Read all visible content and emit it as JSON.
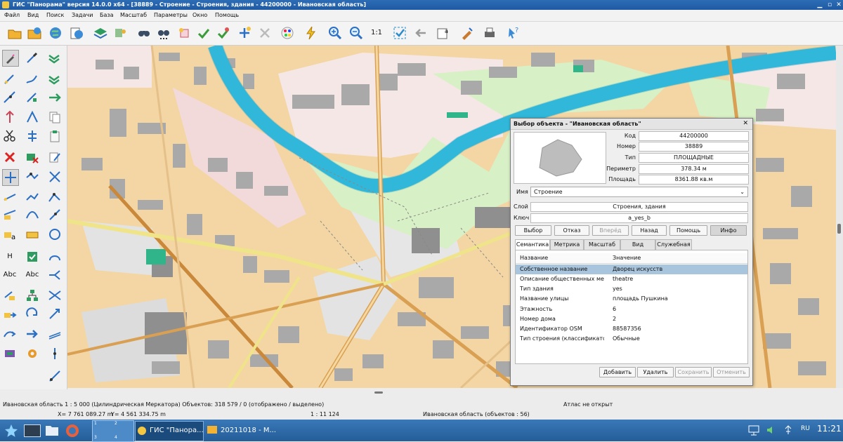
{
  "window": {
    "title": "ГИС \"Панорама\" версия 14.0.0 x64 - [38889 - Строение - Строения, здания - 44200000 - Ивановская область]"
  },
  "menu": [
    "Файл",
    "Вид",
    "Поиск",
    "Задачи",
    "База",
    "Масштаб",
    "Параметры",
    "Окно",
    "Помощь"
  ],
  "toolbar": {
    "zoom_reset_label": "1:1"
  },
  "left_tools": {
    "text_tool_1": "Abc",
    "text_tool_2": "Abc",
    "height_tool": "H"
  },
  "dialog": {
    "title": "Выбор объекта - \"Ивановская область\"",
    "props": [
      {
        "label": "Код",
        "value": "44200000"
      },
      {
        "label": "Номер",
        "value": "38889"
      },
      {
        "label": "Тип",
        "value": "ПЛОЩАДНЫЕ"
      },
      {
        "label": "Периметр",
        "value": "378.34  м"
      },
      {
        "label": "Площадь",
        "value": "8361.88  кв.м"
      }
    ],
    "name_label": "Имя",
    "name_value": "Строение",
    "layer_label": "Слой",
    "layer_value": "Строения, здания",
    "key_label": "Ключ",
    "key_value": "a_yes_b",
    "buttons": [
      "Выбор",
      "Отказ",
      "Вперёд",
      "Назад",
      "Помощь",
      "Инфо"
    ],
    "tabs": [
      "Семантика",
      "Метрика",
      "Масштаб",
      "Вид",
      "Служебная"
    ],
    "table": {
      "col_name": "Название",
      "col_value": "Значение",
      "rows": [
        {
          "name": "Собственное название",
          "value": "Дворец искусств"
        },
        {
          "name": "Описание общественных мест",
          "value": "theatre"
        },
        {
          "name": "Тип здания",
          "value": "yes"
        },
        {
          "name": "Название улицы",
          "value": "площадь Пушкина"
        },
        {
          "name": "Этажность",
          "value": "6"
        },
        {
          "name": "Номер дома",
          "value": "2"
        },
        {
          "name": "Идентификатор OSM",
          "value": "88587356"
        },
        {
          "name": "Тип строения (классификатор)",
          "value": "Обычные"
        }
      ]
    },
    "bottom_buttons": [
      "Добавить",
      "Удалить",
      "Сохранить",
      "Отменить"
    ]
  },
  "status": {
    "line1": "Ивановская область  1 : 5 000 (Цилиндрическая Меркатора) Объектов: 318 579 / 0 (отображено / выделено)",
    "atlas": "Атлас не открыт",
    "x": "X= 7 761 089.27 m",
    "y": "Y= 4 561 334.75 m",
    "scale": "1 : 11 124",
    "region": "Ивановская область  (объектов : 56)"
  },
  "taskbar": {
    "app_label": "ГИС \"Панора...",
    "folder_label": "20211018 - М...",
    "lang": "RU",
    "time": "11:21",
    "desktops": [
      "1",
      "2",
      "3",
      "4"
    ]
  },
  "colors": {
    "title": "#1f5aa2",
    "river": "#39c5e6",
    "building": "#f3c98d",
    "park": "#d8f0c6",
    "selection": "#a9c4dd"
  }
}
